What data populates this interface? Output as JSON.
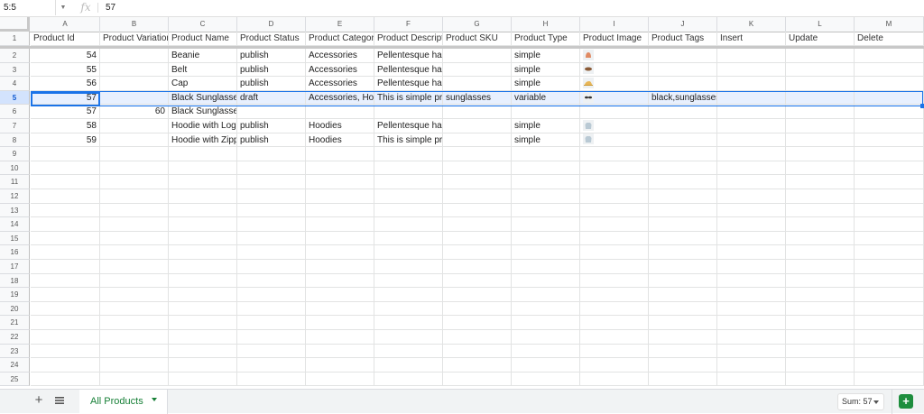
{
  "formula_bar": {
    "name_box": "5:5",
    "fx": "fx",
    "value": "57"
  },
  "columns": [
    "A",
    "B",
    "C",
    "D",
    "E",
    "F",
    "G",
    "H",
    "I",
    "J",
    "K",
    "L",
    "M"
  ],
  "rows": [
    [
      "Product Id",
      "Product Variation",
      "Product Name",
      "Product Status",
      "Product Category",
      "Product Description",
      "Product SKU",
      "Product Type",
      "Product Image",
      "Product Tags",
      "Insert",
      "Update",
      "Delete"
    ],
    [
      "54",
      "",
      "Beanie",
      "publish",
      "Accessories",
      "Pellentesque habitant morbi tristique",
      "",
      "simple",
      "img:beanie",
      "",
      "",
      "",
      ""
    ],
    [
      "55",
      "",
      "Belt",
      "publish",
      "Accessories",
      "Pellentesque habitant morbi tristique",
      "",
      "simple",
      "img:belt",
      "",
      "",
      "",
      ""
    ],
    [
      "56",
      "",
      "Cap",
      "publish",
      "Accessories",
      "Pellentesque habitant morbi tristique",
      "",
      "simple",
      "img:cap",
      "",
      "",
      "",
      ""
    ],
    [
      "57",
      "",
      "Black Sunglasses",
      "draft",
      "Accessories, Hoodies",
      "This is simple product",
      "sunglasses",
      "variable",
      "img:sunglasses",
      "black,sunglasses",
      "",
      "",
      ""
    ],
    [
      "57",
      "60",
      "Black Sunglasses",
      "",
      "",
      "",
      "",
      "",
      "",
      "",
      "",
      "",
      ""
    ],
    [
      "58",
      "",
      "Hoodie with Logo",
      "publish",
      "Hoodies",
      "Pellentesque habitant morbi tristique",
      "",
      "simple",
      "img:hoodie-logo",
      "",
      "",
      "",
      ""
    ],
    [
      "59",
      "",
      "Hoodie with Zipper",
      "publish",
      "Hoodies",
      "This is simple product",
      "",
      "simple",
      "img:hoodie-zip",
      "",
      "",
      "",
      ""
    ]
  ],
  "total_rows": 25,
  "selected_row": 5,
  "sheet_tab": {
    "label": "All Products"
  },
  "status": {
    "sum": "Sum: 57"
  },
  "colors": {
    "accent": "#1a73e8",
    "sheet_green": "#188038",
    "selection_fill": "#e8f0fe"
  }
}
